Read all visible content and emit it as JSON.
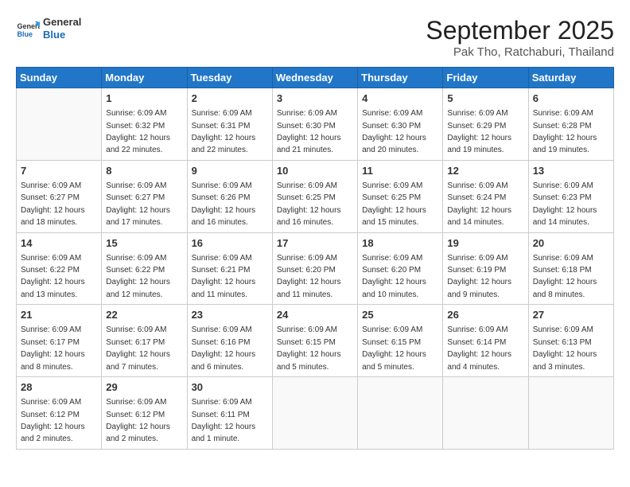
{
  "header": {
    "logo_line1": "General",
    "logo_line2": "Blue",
    "month": "September 2025",
    "location": "Pak Tho, Ratchaburi, Thailand"
  },
  "weekdays": [
    "Sunday",
    "Monday",
    "Tuesday",
    "Wednesday",
    "Thursday",
    "Friday",
    "Saturday"
  ],
  "weeks": [
    [
      {
        "day": null
      },
      {
        "day": "1",
        "sunrise": "6:09 AM",
        "sunset": "6:32 PM",
        "daylight": "12 hours and 22 minutes."
      },
      {
        "day": "2",
        "sunrise": "6:09 AM",
        "sunset": "6:31 PM",
        "daylight": "12 hours and 22 minutes."
      },
      {
        "day": "3",
        "sunrise": "6:09 AM",
        "sunset": "6:30 PM",
        "daylight": "12 hours and 21 minutes."
      },
      {
        "day": "4",
        "sunrise": "6:09 AM",
        "sunset": "6:30 PM",
        "daylight": "12 hours and 20 minutes."
      },
      {
        "day": "5",
        "sunrise": "6:09 AM",
        "sunset": "6:29 PM",
        "daylight": "12 hours and 19 minutes."
      },
      {
        "day": "6",
        "sunrise": "6:09 AM",
        "sunset": "6:28 PM",
        "daylight": "12 hours and 19 minutes."
      }
    ],
    [
      {
        "day": "7",
        "sunrise": "6:09 AM",
        "sunset": "6:27 PM",
        "daylight": "12 hours and 18 minutes."
      },
      {
        "day": "8",
        "sunrise": "6:09 AM",
        "sunset": "6:27 PM",
        "daylight": "12 hours and 17 minutes."
      },
      {
        "day": "9",
        "sunrise": "6:09 AM",
        "sunset": "6:26 PM",
        "daylight": "12 hours and 16 minutes."
      },
      {
        "day": "10",
        "sunrise": "6:09 AM",
        "sunset": "6:25 PM",
        "daylight": "12 hours and 16 minutes."
      },
      {
        "day": "11",
        "sunrise": "6:09 AM",
        "sunset": "6:25 PM",
        "daylight": "12 hours and 15 minutes."
      },
      {
        "day": "12",
        "sunrise": "6:09 AM",
        "sunset": "6:24 PM",
        "daylight": "12 hours and 14 minutes."
      },
      {
        "day": "13",
        "sunrise": "6:09 AM",
        "sunset": "6:23 PM",
        "daylight": "12 hours and 14 minutes."
      }
    ],
    [
      {
        "day": "14",
        "sunrise": "6:09 AM",
        "sunset": "6:22 PM",
        "daylight": "12 hours and 13 minutes."
      },
      {
        "day": "15",
        "sunrise": "6:09 AM",
        "sunset": "6:22 PM",
        "daylight": "12 hours and 12 minutes."
      },
      {
        "day": "16",
        "sunrise": "6:09 AM",
        "sunset": "6:21 PM",
        "daylight": "12 hours and 11 minutes."
      },
      {
        "day": "17",
        "sunrise": "6:09 AM",
        "sunset": "6:20 PM",
        "daylight": "12 hours and 11 minutes."
      },
      {
        "day": "18",
        "sunrise": "6:09 AM",
        "sunset": "6:20 PM",
        "daylight": "12 hours and 10 minutes."
      },
      {
        "day": "19",
        "sunrise": "6:09 AM",
        "sunset": "6:19 PM",
        "daylight": "12 hours and 9 minutes."
      },
      {
        "day": "20",
        "sunrise": "6:09 AM",
        "sunset": "6:18 PM",
        "daylight": "12 hours and 8 minutes."
      }
    ],
    [
      {
        "day": "21",
        "sunrise": "6:09 AM",
        "sunset": "6:17 PM",
        "daylight": "12 hours and 8 minutes."
      },
      {
        "day": "22",
        "sunrise": "6:09 AM",
        "sunset": "6:17 PM",
        "daylight": "12 hours and 7 minutes."
      },
      {
        "day": "23",
        "sunrise": "6:09 AM",
        "sunset": "6:16 PM",
        "daylight": "12 hours and 6 minutes."
      },
      {
        "day": "24",
        "sunrise": "6:09 AM",
        "sunset": "6:15 PM",
        "daylight": "12 hours and 5 minutes."
      },
      {
        "day": "25",
        "sunrise": "6:09 AM",
        "sunset": "6:15 PM",
        "daylight": "12 hours and 5 minutes."
      },
      {
        "day": "26",
        "sunrise": "6:09 AM",
        "sunset": "6:14 PM",
        "daylight": "12 hours and 4 minutes."
      },
      {
        "day": "27",
        "sunrise": "6:09 AM",
        "sunset": "6:13 PM",
        "daylight": "12 hours and 3 minutes."
      }
    ],
    [
      {
        "day": "28",
        "sunrise": "6:09 AM",
        "sunset": "6:12 PM",
        "daylight": "12 hours and 2 minutes."
      },
      {
        "day": "29",
        "sunrise": "6:09 AM",
        "sunset": "6:12 PM",
        "daylight": "12 hours and 2 minutes."
      },
      {
        "day": "30",
        "sunrise": "6:09 AM",
        "sunset": "6:11 PM",
        "daylight": "12 hours and 1 minute."
      },
      {
        "day": null
      },
      {
        "day": null
      },
      {
        "day": null
      },
      {
        "day": null
      }
    ]
  ]
}
